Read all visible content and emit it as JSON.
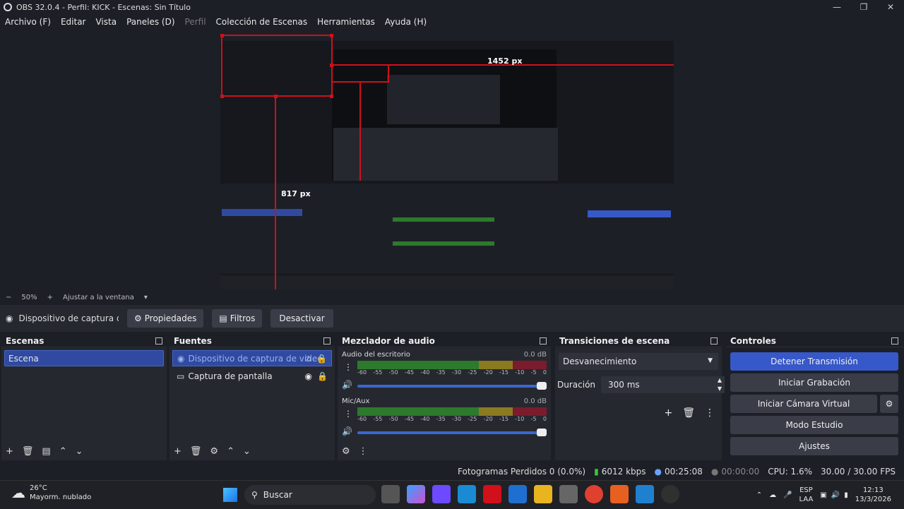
{
  "window": {
    "title": "OBS 32.0.4 - Perfil: KICK - Escenas: Sin Título"
  },
  "menu": [
    "Archivo (F)",
    "Editar",
    "Vista",
    "Paneles (D)",
    "Perfil",
    "Colección de Escenas",
    "Herramientas",
    "Ayuda (H)"
  ],
  "preview": {
    "labels": {
      "width": "1452 px",
      "height": "817 px"
    },
    "inner_title": "OBS 32.0.4 - Perfil: KICK - Escenas: Sin Título"
  },
  "zoom": {
    "minus": "−",
    "level": "50%",
    "plus": "+",
    "fit": "Ajustar a la ventana"
  },
  "source_bar": {
    "name": "Dispositivo de captura de v",
    "props": "Propiedades",
    "filters": "Filtros",
    "deactivate": "Desactivar"
  },
  "docks": {
    "scenes": {
      "title": "Escenas",
      "items": [
        "Escena"
      ]
    },
    "sources": {
      "title": "Fuentes",
      "items": [
        "Dispositivo de captura de video",
        "Captura de pantalla"
      ]
    },
    "mixer": {
      "title": "Mezclador de audio",
      "channels": [
        {
          "name": "Audio del escritorio",
          "db": "0.0 dB"
        },
        {
          "name": "Mic/Aux",
          "db": "0.0 dB"
        }
      ],
      "ticks": [
        "-60",
        "-55",
        "-50",
        "-45",
        "-40",
        "-35",
        "-30",
        "-25",
        "-20",
        "-15",
        "-10",
        "-5",
        "0"
      ]
    },
    "transitions": {
      "title": "Transiciones de escena",
      "selected": "Desvanecimiento",
      "duration_label": "Duración",
      "duration_value": "300 ms"
    },
    "controls": {
      "title": "Controles",
      "buttons": [
        "Detener Transmisión",
        "Iniciar Grabación",
        "Iniciar Cámara Virtual",
        "Modo Estudio",
        "Ajustes"
      ]
    }
  },
  "status": {
    "dropped": "Fotogramas Perdidos 0 (0.0%)",
    "bitrate": "6012 kbps",
    "stream_time": "00:25:08",
    "rec_time": "00:00:00",
    "cpu": "CPU: 1.6%",
    "fps": "30.00 / 30.00 FPS"
  },
  "taskbar": {
    "weather_temp": "26°C",
    "weather_desc": "Mayorm. nublado",
    "search": "Buscar",
    "lang1": "ESP",
    "lang2": "LAA",
    "time": "12:13",
    "date": "13/3/2026"
  },
  "colors": {
    "accent": "#3758c8",
    "bg": "#1d1f26",
    "panel": "#262830",
    "red": "#d0101a"
  }
}
